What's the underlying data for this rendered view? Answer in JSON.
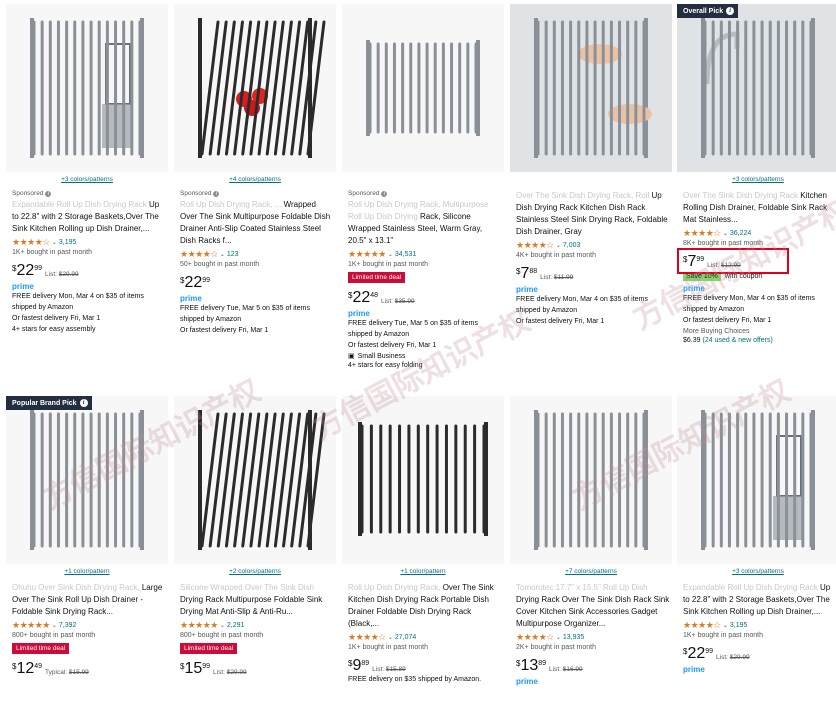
{
  "watermark": "方信国际知识产权",
  "cards": [
    {
      "colors": "+3 colors/patterns",
      "sponsored": "Sponsored",
      "title_faded": "Expandable Roll Up Dish Drying Rack",
      "title": "Up to 22.8\" with 2 Storage Baskets,Over The Sink Kitchen Rolling up Dish Drainer,...",
      "stars": "★★★★☆",
      "count": "3,195",
      "bought": "1K+ bought in past month",
      "price_whole": "22",
      "price_frac": "99",
      "list": "$29.99",
      "list_label": "List:",
      "prime": "prime",
      "delivery": "FREE delivery Mon, Mar 4 on $35 of items shipped by Amazon",
      "fastest": "Or fastest delivery Fri, Mar 1",
      "extra": "4+ stars for easy assembly"
    },
    {
      "colors": "+4 colors/patterns",
      "sponsored": "Sponsored",
      "title_faded": "Roll Up Dish Drying Rack, ...",
      "title": "Wrapped Over The Sink Multipurpose Foldable Dish Drainer Anti-Slip Coated Stainless Steel Dish Racks f...",
      "stars": "★★★★☆",
      "count": "123",
      "bought": "50+ bought in past month",
      "price_whole": "22",
      "price_frac": "99",
      "prime": "prime",
      "delivery": "FREE delivery Tue, Mar 5 on $35 of items shipped by Amazon",
      "fastest": "Or fastest delivery Fri, Mar 1"
    },
    {
      "colors": "",
      "sponsored": "Sponsored",
      "title_faded": "Roll Up Dish Drying Rack, Multipurpose Roll Up Dish Drying",
      "title": "Rack, Silicone Wrapped Stainless Steel, Warm Gray, 20.5\" x 13.1\"",
      "stars": "★★★★★",
      "count": "34,531",
      "bought": "1K+ bought in past month",
      "deal": "Limited time deal",
      "price_whole": "22",
      "price_frac": "48",
      "list": "$35.99",
      "list_label": "List:",
      "prime": "prime",
      "delivery": "FREE delivery Tue, Mar 5 on $35 of items shipped by Amazon",
      "fastest": "Or fastest delivery Fri, Mar 1",
      "small_business": "Small Business",
      "extra": "4+ stars for easy folding"
    },
    {
      "colors": "",
      "title_faded": "Over The Sink Dish Drying Rack, Roll",
      "title": "Up Dish Drying Rack Kitchen Dish Rack Stainless Steel Sink Drying Rack, Foldable Dish Drainer, Gray",
      "stars": "★★★★☆",
      "count": "7,003",
      "bought": "4K+ bought in past month",
      "price_whole": "7",
      "price_frac": "88",
      "list": "$11.99",
      "list_label": "List:",
      "prime": "prime",
      "delivery": "FREE delivery Mon, Mar 4 on $35 of items shipped by Amazon",
      "fastest": "Or fastest delivery Fri, Mar 1"
    },
    {
      "badge": "Overall Pick",
      "colors": "+3 colors/patterns",
      "title_faded": "Over The Sink Dish Drying Rack",
      "title": "Kitchen Rolling Dish Drainer, Foldable Sink Rack Mat Stainless...",
      "stars": "★★★★☆",
      "count": "36,224",
      "bought": "8K+ bought in past month",
      "price_whole": "7",
      "price_frac": "99",
      "list": "$12.99",
      "list_label": "List:",
      "save_tag": "Save 10%",
      "save_text": "with coupon",
      "prime": "prime",
      "delivery": "FREE delivery Mon, Mar 4 on $35 of items shipped by Amazon",
      "fastest": "Or fastest delivery Fri, Mar 1",
      "more_label": "More Buying Choices",
      "more_price": "$6.39",
      "more_link": "(24 used & new offers)"
    },
    {
      "badge": "Popular Brand Pick",
      "colors": "+1 color/pattern",
      "title_faded": "Ohuhu Over Sink Dish Drying Rack,",
      "title": "Large Over The Sink Roll Up Dish Drainer - Foldable Sink Drying Rack...",
      "stars": "★★★★★",
      "count": "7,392",
      "bought": "800+ bought in past month",
      "deal": "Limited time deal",
      "price_whole": "12",
      "price_frac": "49",
      "list": "$15.99",
      "list_label": "Typical:"
    },
    {
      "colors": "+2 colors/patterns",
      "title_faded": "Silicone Wrapped Over The Sink Dish",
      "title": "Drying Rack Multipurpose Foldable Sink Drying Mat Anti-Slip & Anti-Ru...",
      "stars": "★★★★★",
      "count": "2,291",
      "bought": "800+ bought in past month",
      "deal": "Limited time deal",
      "price_whole": "15",
      "price_frac": "99",
      "list": "$29.99",
      "list_label": "List:"
    },
    {
      "colors": "+1 color/pattern",
      "title_faded": "Roll Up Dish Drying Rack,",
      "title": "Over The Sink Kitchen Dish Drying Rack Portable Dish Drainer Foldable Dish Drying Rack (Black,...",
      "stars": "★★★★☆",
      "count": "27,074",
      "bought": "1K+ bought in past month",
      "price_whole": "9",
      "price_frac": "89",
      "list": "$15.89",
      "list_label": "List:",
      "delivery": "FREE delivery on $35 shipped by Amazon."
    },
    {
      "colors": "+7 colors/patterns",
      "title_faded": "Tomorotec 17.7\" x 15.5\" Roll Up Dish",
      "title": "Drying Rack Over The Sink Dish Rack Sink Cover Kitchen Sink Accessories Gadget Multipurpose Organizer...",
      "stars": "★★★★☆",
      "count": "13,935",
      "bought": "2K+ bought in past month",
      "price_whole": "13",
      "price_frac": "89",
      "list": "$16.99",
      "list_label": "List:",
      "prime": "prime"
    },
    {
      "colors": "+3 colors/patterns",
      "title_faded": "Expandable Roll Up Dish Drying Rack",
      "title": "Up to 22.8\" with 2 Storage Baskets,Over The Sink Kitchen Rolling up Dish Drainer,...",
      "stars": "★★★★☆",
      "count": "3,195",
      "bought": "1K+ bought in past month",
      "price_whole": "22",
      "price_frac": "99",
      "list": "$29.99",
      "list_label": "List:",
      "prime": "prime"
    }
  ]
}
